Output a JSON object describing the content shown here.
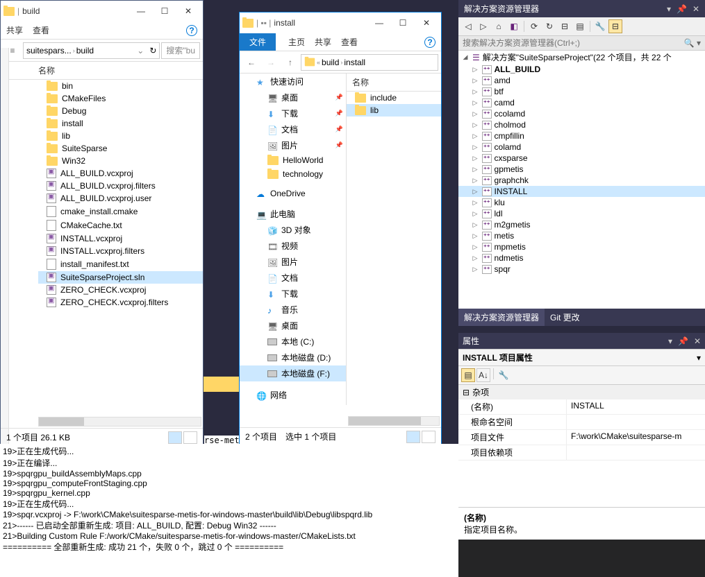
{
  "explorer1": {
    "title": "build",
    "tabs": {
      "share": "共享",
      "view": "查看"
    },
    "breadcrumb": [
      "suitespars...",
      "build"
    ],
    "search_placeholder": "搜索\"bu",
    "col_name": "名称",
    "files": [
      {
        "name": "bin",
        "type": "folder"
      },
      {
        "name": "CMakeFiles",
        "type": "folder"
      },
      {
        "name": "Debug",
        "type": "folder"
      },
      {
        "name": "install",
        "type": "folder"
      },
      {
        "name": "lib",
        "type": "folder"
      },
      {
        "name": "SuiteSparse",
        "type": "folder"
      },
      {
        "name": "Win32",
        "type": "folder"
      },
      {
        "name": "ALL_BUILD.vcxproj",
        "type": "vcx"
      },
      {
        "name": "ALL_BUILD.vcxproj.filters",
        "type": "vcx"
      },
      {
        "name": "ALL_BUILD.vcxproj.user",
        "type": "vcx"
      },
      {
        "name": "cmake_install.cmake",
        "type": "file"
      },
      {
        "name": "CMakeCache.txt",
        "type": "file"
      },
      {
        "name": "INSTALL.vcxproj",
        "type": "vcx"
      },
      {
        "name": "INSTALL.vcxproj.filters",
        "type": "vcx"
      },
      {
        "name": "install_manifest.txt",
        "type": "file"
      },
      {
        "name": "SuiteSparseProject.sln",
        "type": "vcx",
        "selected": true
      },
      {
        "name": "ZERO_CHECK.vcxproj",
        "type": "vcx"
      },
      {
        "name": "ZERO_CHECK.vcxproj.filters",
        "type": "vcx"
      }
    ],
    "status": "1 个项目   26.1 KB"
  },
  "explorer2": {
    "title": "install",
    "tabs": {
      "file": "文件",
      "home": "主页",
      "share": "共享",
      "view": "查看"
    },
    "breadcrumb": [
      "build",
      "install"
    ],
    "col_name": "名称",
    "sidebar": {
      "quick": "快速访问",
      "items1": [
        {
          "name": "桌面",
          "icon": "desktop"
        },
        {
          "name": "下载",
          "icon": "download"
        },
        {
          "name": "文档",
          "icon": "doc"
        },
        {
          "name": "图片",
          "icon": "pic"
        },
        {
          "name": "HelloWorld",
          "icon": "folder"
        },
        {
          "name": "technology",
          "icon": "folder"
        }
      ],
      "onedrive": "OneDrive",
      "thispc": "此电脑",
      "items2": [
        {
          "name": "3D 对象",
          "icon": "3d"
        },
        {
          "name": "视频",
          "icon": "video"
        },
        {
          "name": "图片",
          "icon": "pic"
        },
        {
          "name": "文档",
          "icon": "doc"
        },
        {
          "name": "下载",
          "icon": "download"
        },
        {
          "name": "音乐",
          "icon": "music"
        },
        {
          "name": "桌面",
          "icon": "desktop"
        },
        {
          "name": "本地 (C:)",
          "icon": "disk"
        },
        {
          "name": "本地磁盘 (D:)",
          "icon": "disk"
        },
        {
          "name": "本地磁盘 (F:)",
          "icon": "disk",
          "selected": true
        }
      ],
      "network": "网络"
    },
    "files": [
      {
        "name": "include",
        "type": "folder"
      },
      {
        "name": "lib",
        "type": "folder",
        "selected": true
      }
    ],
    "status_left": "2 个项目",
    "status_right": "选中 1 个项目"
  },
  "vs": {
    "title": "解决方案资源管理器",
    "search_placeholder": "搜索解决方案资源管理器(Ctrl+;)",
    "solution": "解决方案\"SuiteSparseProject\"(22 个项目，共 22 个",
    "projects": [
      {
        "name": "ALL_BUILD",
        "bold": true
      },
      {
        "name": "amd"
      },
      {
        "name": "btf"
      },
      {
        "name": "camd"
      },
      {
        "name": "ccolamd"
      },
      {
        "name": "cholmod"
      },
      {
        "name": "cmpfillin"
      },
      {
        "name": "colamd"
      },
      {
        "name": "cxsparse"
      },
      {
        "name": "gpmetis"
      },
      {
        "name": "graphchk"
      },
      {
        "name": "INSTALL",
        "selected": true
      },
      {
        "name": "klu"
      },
      {
        "name": "ldl"
      },
      {
        "name": "m2gmetis"
      },
      {
        "name": "metis"
      },
      {
        "name": "mpmetis"
      },
      {
        "name": "ndmetis"
      },
      {
        "name": "spqr"
      }
    ],
    "tabs": {
      "sol": "解决方案资源管理器",
      "git": "Git 更改"
    },
    "properties": {
      "title": "属性",
      "header": "INSTALL 项目属性",
      "category": "杂项",
      "rows": [
        {
          "key": "(名称)",
          "val": "INSTALL"
        },
        {
          "key": "根命名空间",
          "val": ""
        },
        {
          "key": "项目文件",
          "val": "F:\\work\\CMake\\suitesparse-m"
        },
        {
          "key": "项目依赖项",
          "val": ""
        }
      ],
      "desc_title": "(名称)",
      "desc_text": "指定项目名称。"
    }
  },
  "output": [
    "19>正在生成代码...",
    "19>正在编译...",
    "19>spqrgpu_buildAssemblyMaps.cpp",
    "19>spqrgpu_computeFrontStaging.cpp",
    "19>spqrgpu_kernel.cpp",
    "19>正在生成代码...",
    "19>spqr.vcxproj -> F:\\work\\CMake\\suitesparse-metis-for-windows-master\\build\\lib\\Debug\\libspqrd.lib",
    "21>------ 已启动全部重新生成: 项目: ALL_BUILD, 配置: Debug Win32 ------",
    "21>Building Custom Rule F:/work/CMake/suitesparse-metis-for-windows-master/CMakeLists.txt",
    "========== 全部重新生成: 成功 21 个，失败 0 个，跳过 0 个 =========="
  ],
  "fragment": "rse-metis-"
}
